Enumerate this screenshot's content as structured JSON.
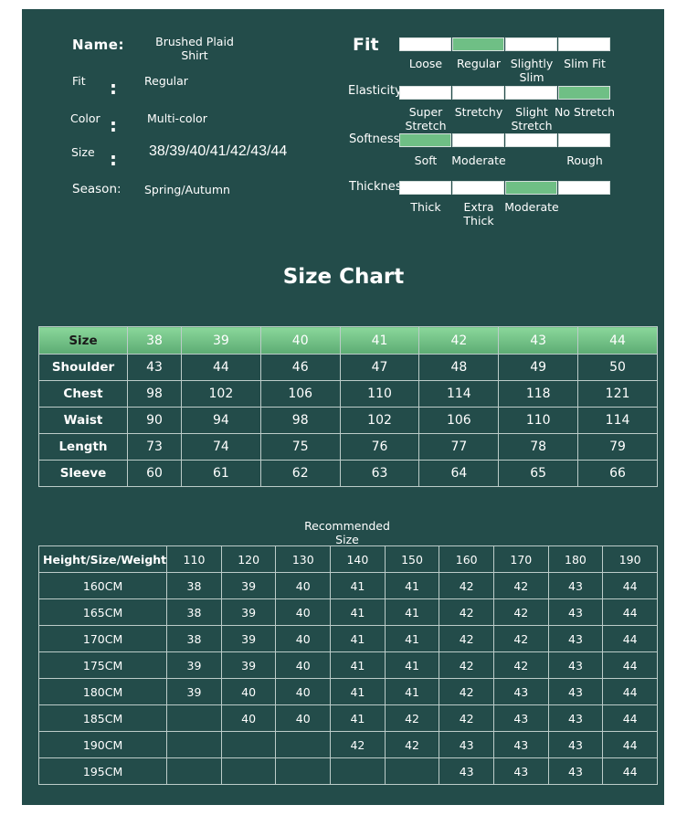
{
  "info": {
    "name_label": "Name:",
    "name_value": "Brushed Plaid Shirt",
    "fit_label": "Fit",
    "fit_value": "Regular",
    "color_label": "Color",
    "color_value": "Multi-color",
    "size_label": "Size",
    "size_value": "38/39/40/41/42/43/44",
    "season_label": "Season:",
    "season_value": "Spring/Autumn",
    "colon": ":"
  },
  "ratings": [
    {
      "title": "Fit",
      "labels": [
        "Loose",
        "Regular",
        "Slightly Slim",
        "Slim Fit"
      ],
      "selected": 1
    },
    {
      "title": "Elasticity",
      "labels": [
        "Super Stretch",
        "Stretchy",
        "Slight Stretch",
        "No Stretch"
      ],
      "selected": 3
    },
    {
      "title": "Softness",
      "labels": [
        "Soft",
        "Moderate",
        "",
        "Rough"
      ],
      "selected": 0
    },
    {
      "title": "Thickness",
      "labels": [
        "Thick",
        "Extra Thick",
        "Moderate",
        ""
      ],
      "selected": 2
    }
  ],
  "size_chart": {
    "title": "Size Chart",
    "header": [
      "Size",
      "38",
      "39",
      "40",
      "41",
      "42",
      "43",
      "44"
    ],
    "rows": [
      [
        "Shoulder",
        "43",
        "44",
        "46",
        "47",
        "48",
        "49",
        "50"
      ],
      [
        "Chest",
        "98",
        "102",
        "106",
        "110",
        "114",
        "118",
        "121"
      ],
      [
        "Waist",
        "90",
        "94",
        "98",
        "102",
        "106",
        "110",
        "114"
      ],
      [
        "Length",
        "73",
        "74",
        "75",
        "76",
        "77",
        "78",
        "79"
      ],
      [
        "Sleeve",
        "60",
        "61",
        "62",
        "63",
        "64",
        "65",
        "66"
      ]
    ]
  },
  "recommended": {
    "title": "Recommended Size",
    "header": [
      "Height/Size/Weight",
      "110",
      "120",
      "130",
      "140",
      "150",
      "160",
      "170",
      "180",
      "190"
    ],
    "rows": [
      [
        "160CM",
        "38",
        "39",
        "40",
        "41",
        "41",
        "42",
        "42",
        "43",
        "44"
      ],
      [
        "165CM",
        "38",
        "39",
        "40",
        "41",
        "41",
        "42",
        "42",
        "43",
        "44"
      ],
      [
        "170CM",
        "38",
        "39",
        "40",
        "41",
        "41",
        "42",
        "42",
        "43",
        "44"
      ],
      [
        "175CM",
        "39",
        "39",
        "40",
        "41",
        "41",
        "42",
        "42",
        "43",
        "44"
      ],
      [
        "180CM",
        "39",
        "40",
        "40",
        "41",
        "41",
        "42",
        "43",
        "43",
        "44"
      ],
      [
        "185CM",
        "",
        "40",
        "40",
        "41",
        "42",
        "42",
        "43",
        "43",
        "44"
      ],
      [
        "190CM",
        "",
        "",
        "",
        "42",
        "42",
        "43",
        "43",
        "43",
        "44"
      ],
      [
        "195CM",
        "",
        "",
        "",
        "",
        "",
        "43",
        "43",
        "43",
        "44"
      ]
    ]
  },
  "colors": {
    "panel": "#234c4a",
    "accent": "#6fbf85"
  }
}
